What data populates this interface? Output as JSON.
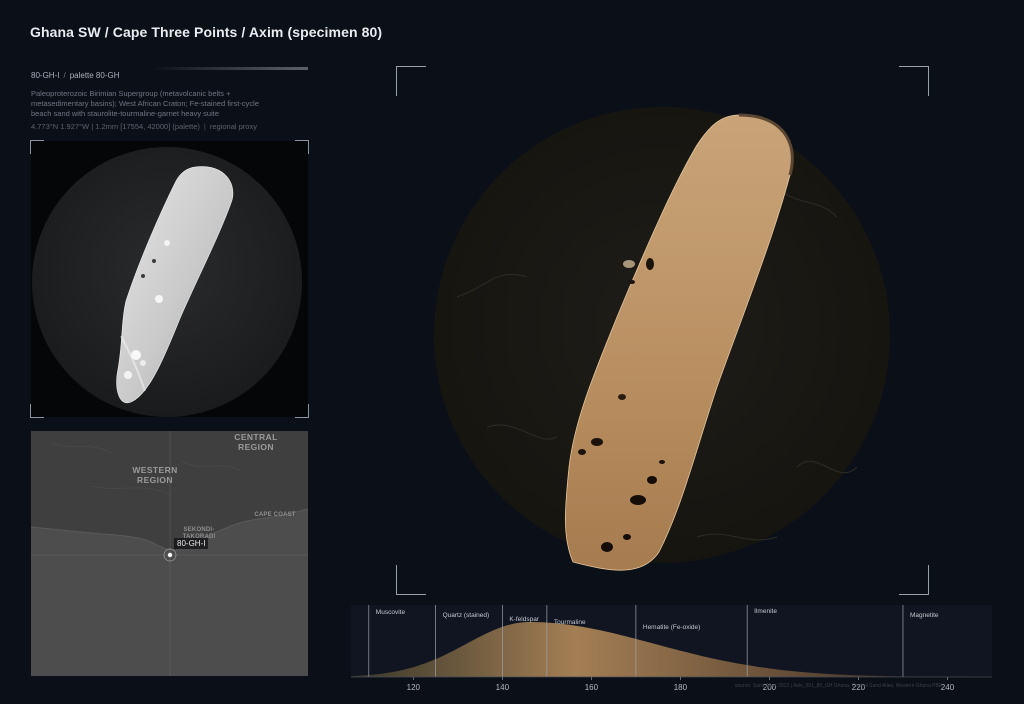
{
  "header": {
    "title": "Ghana SW / Cape Three Points / Axim (specimen 80)"
  },
  "specimen": {
    "id": "80-GH-I",
    "separator": "/",
    "palette": "palette 80-GH",
    "description": "Paleoproterozoic Birimian Supergroup (metavolcanic belts + metasedimentary basins); West African Craton; Fe-stained first-cycle beach sand with staurolite-tourmaline-garnet heavy suite",
    "meta_range": "4.773°N 1.927°W | 1.2mm [17554, 42000] (palette)",
    "meta_proxy": "regional proxy"
  },
  "map": {
    "regions": [
      {
        "name": "WESTERN",
        "name2": "REGION"
      },
      {
        "name": "CENTRAL",
        "name2": "REGION"
      }
    ],
    "towns": [
      "SEKONDI-",
      "TAKORADI",
      "CAPE COAST"
    ],
    "marker_label": "80-GH-I",
    "land_color": "#3f3f3f",
    "sea_color": "#4d4d4d"
  },
  "histogram": {
    "minerals": [
      {
        "name": "Muscovite",
        "value": 110
      },
      {
        "name": "Quartz (stained)",
        "value": 125
      },
      {
        "name": "K-feldspar",
        "value": 140
      },
      {
        "name": "Tourmaline",
        "value": 150
      },
      {
        "name": "Hematite (Fe-oxide)",
        "value": 170
      },
      {
        "name": "Ilmenite",
        "value": 195
      },
      {
        "name": "Magnetite",
        "value": 230
      }
    ],
    "ticks": [
      "120",
      "140",
      "160",
      "180",
      "200",
      "220",
      "240"
    ],
    "tick_values": [
      120,
      140,
      160,
      180,
      200,
      220,
      240
    ],
    "x_range": [
      106,
      250
    ],
    "fill_color": "#b48a5a"
  },
  "credit": "source: Sand Atlas 2013 | 4alo_001_80_GH Ghana, Central Sand Atlas, Western Ghana PBE",
  "colors": {
    "background": "#0b0f17",
    "grain_tan": "#c8a273",
    "grain_gray": "#cfcfcf"
  }
}
